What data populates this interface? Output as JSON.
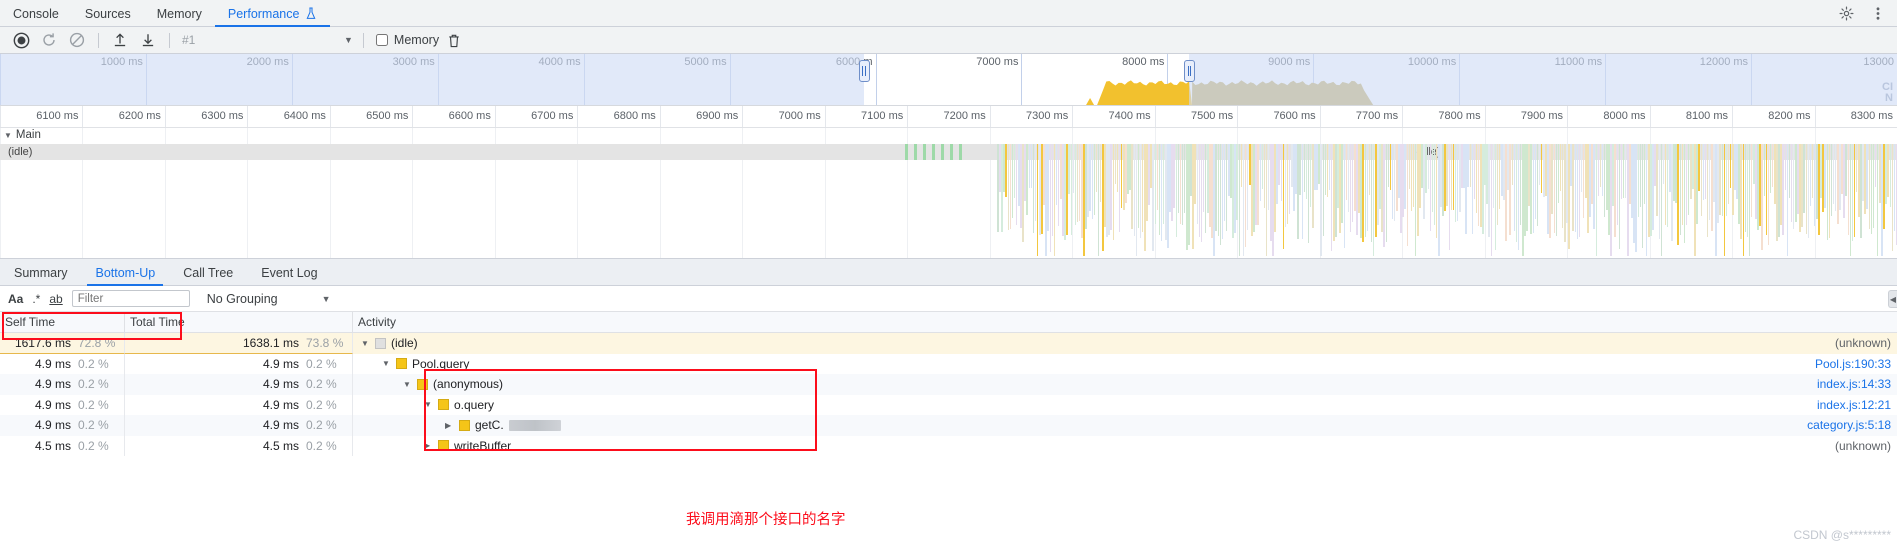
{
  "devtools_tabs": [
    {
      "label": "Console",
      "active": false,
      "icon": null
    },
    {
      "label": "Sources",
      "active": false,
      "icon": null
    },
    {
      "label": "Memory",
      "active": false,
      "icon": null
    },
    {
      "label": "Performance",
      "active": true,
      "icon": "flask-icon"
    }
  ],
  "tabbar_right": [
    {
      "name": "settings-gear-icon"
    },
    {
      "name": "more-options-icon"
    }
  ],
  "toolbar": {
    "record_button": "record-icon",
    "reload_button": "reload-record-icon",
    "clear_button": "clear-icon",
    "load_button": "load-profile-icon",
    "save_button": "save-profile-icon",
    "recording_name": "#1",
    "dropdown_arrow": "▼",
    "memory_label": "Memory",
    "memory_checked": false,
    "trash_button": "collect-garbage-icon"
  },
  "overview": {
    "ticks": [
      "1000 ms",
      "2000 ms",
      "3000 ms",
      "4000 ms",
      "5000 ms",
      "6000 m",
      "7000 ms",
      "8000 ms",
      "9000 ms",
      "10000 ms",
      "11000 ms",
      "12000 ms",
      "13000"
    ],
    "selection_start_ms": 6100,
    "selection_end_ms": 8400,
    "cpu_color": "#f2c12e",
    "cpu_color_dim": "#c5ae62",
    "dim_color": "#cfdcf5",
    "watermark_line1": "CI",
    "watermark_line2": "N"
  },
  "detail_ruler": {
    "ticks": [
      "6100 ms",
      "6200 ms",
      "6300 ms",
      "6400 ms",
      "6500 ms",
      "6600 ms",
      "6700 ms",
      "6800 ms",
      "6900 ms",
      "7000 ms",
      "7100 ms",
      "7200 ms",
      "7300 ms",
      "7400 ms",
      "7500 ms",
      "7600 ms",
      "7700 ms",
      "7800 ms",
      "7900 ms",
      "8000 ms",
      "8100 ms",
      "8200 ms",
      "8300 ms"
    ]
  },
  "flame": {
    "group_label": "Main",
    "group_caret": "▼",
    "idle_left_label": "(idle)",
    "idle_right_label": "(idle)"
  },
  "lower_tabs": [
    {
      "label": "Summary",
      "active": false
    },
    {
      "label": "Bottom-Up",
      "active": true
    },
    {
      "label": "Call Tree",
      "active": false
    },
    {
      "label": "Event Log",
      "active": false
    }
  ],
  "filterbar": {
    "match_case_label": "Aa",
    "regex_label": ".*",
    "whole_word_label": "ab",
    "filter_placeholder": "Filter",
    "filter_value": "",
    "grouping_label": "No Grouping",
    "grouping_arrow": "▼"
  },
  "table": {
    "columns": [
      "Self Time",
      "Total Time",
      "Activity"
    ],
    "rows": [
      {
        "self_time": "1617.6 ms",
        "self_pct": "72.8 %",
        "total_time": "1638.1 ms",
        "total_pct": "73.8 %",
        "indent": 0,
        "caret": "▼",
        "swatch": "#e0e0e0",
        "activity": "(idle)",
        "link": "(unknown)",
        "link_kind": "plain",
        "highlight": true,
        "blurred": false
      },
      {
        "self_time": "4.9 ms",
        "self_pct": "0.2 %",
        "total_time": "4.9 ms",
        "total_pct": "0.2 %",
        "indent": 1,
        "caret": "▼",
        "swatch": "#f5c518",
        "activity": "Pool.query",
        "link": "Pool.js:190:33",
        "link_kind": "link",
        "highlight": false,
        "blurred": false
      },
      {
        "self_time": "4.9 ms",
        "self_pct": "0.2 %",
        "total_time": "4.9 ms",
        "total_pct": "0.2 %",
        "indent": 2,
        "caret": "▼",
        "swatch": "#f5c518",
        "activity": "(anonymous)",
        "link": "index.js:14:33",
        "link_kind": "link",
        "highlight": false,
        "blurred": false
      },
      {
        "self_time": "4.9 ms",
        "self_pct": "0.2 %",
        "total_time": "4.9 ms",
        "total_pct": "0.2 %",
        "indent": 3,
        "caret": "▼",
        "swatch": "#f5c518",
        "activity": "o.query",
        "link": "index.js:12:21",
        "link_kind": "link",
        "highlight": false,
        "blurred": false
      },
      {
        "self_time": "4.9 ms",
        "self_pct": "0.2 %",
        "total_time": "4.9 ms",
        "total_pct": "0.2 %",
        "indent": 4,
        "caret": "▶",
        "swatch": "#f5c518",
        "activity": "getC.",
        "link": "category.js:5:18",
        "link_kind": "link",
        "highlight": false,
        "blurred": true
      },
      {
        "self_time": "4.5 ms",
        "self_pct": "0.2 %",
        "total_time": "4.5 ms",
        "total_pct": "0.2 %",
        "indent": 3,
        "caret": "▶",
        "swatch": "#f5c518",
        "activity": "writeBuffer",
        "link": "(unknown)",
        "link_kind": "plain",
        "highlight": false,
        "blurred": false
      }
    ]
  },
  "annotations": {
    "chinese_note": "我调用滴那个接口的名字",
    "box_color": "#fc0d1b"
  },
  "watermark": "CSDN @s*********"
}
